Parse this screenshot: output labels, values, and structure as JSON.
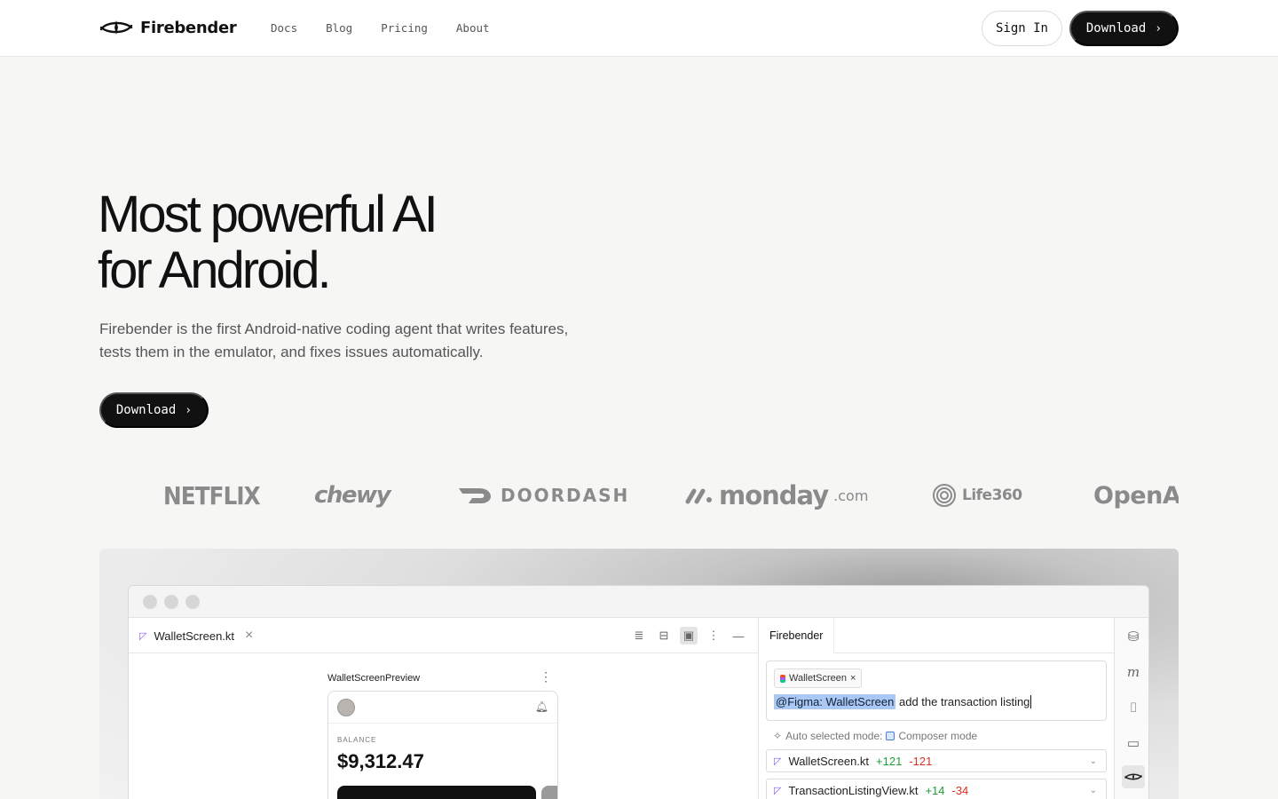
{
  "nav": {
    "brand": "Firebender",
    "links": [
      "Docs",
      "Blog",
      "Pricing",
      "About"
    ],
    "sign_in": "Sign In",
    "download": "Download"
  },
  "hero": {
    "title_line1": "Most powerful AI",
    "title_line2": "for Android.",
    "subtitle": "Firebender is the first Android-native coding agent that writes features, tests them in the emulator, and fixes issues automatically.",
    "download": "Download"
  },
  "logos": {
    "netflix": "NETFLIX",
    "chewy": "chewy",
    "doordash": "DOORDASH",
    "monday": "monday",
    "monday_suffix": ".com",
    "life360": "Life360",
    "openai": "OpenA"
  },
  "ide": {
    "editor_tab": "WalletScreen.kt",
    "preview_label": "WalletScreenPreview",
    "phone": {
      "balance_label": "BALANCE",
      "balance": "$9,312.47"
    },
    "panel_tab": "Firebender",
    "chip": "WalletScreen",
    "prompt_mention": "@Figma: WalletScreen",
    "prompt_text": " add the transaction listing",
    "mode_prefix": "Auto selected mode:",
    "mode_name": "Composer mode",
    "files": [
      {
        "name": "WalletScreen.kt",
        "added": "+121",
        "removed": "-121"
      },
      {
        "name": "TransactionListingView.kt",
        "added": "+14",
        "removed": "-34"
      }
    ]
  },
  "colors": {
    "primary": "#111111",
    "background": "#f6f6f5",
    "added": "#1f9d3a",
    "removed": "#d93025",
    "mention_highlight": "#a9c8f5"
  }
}
